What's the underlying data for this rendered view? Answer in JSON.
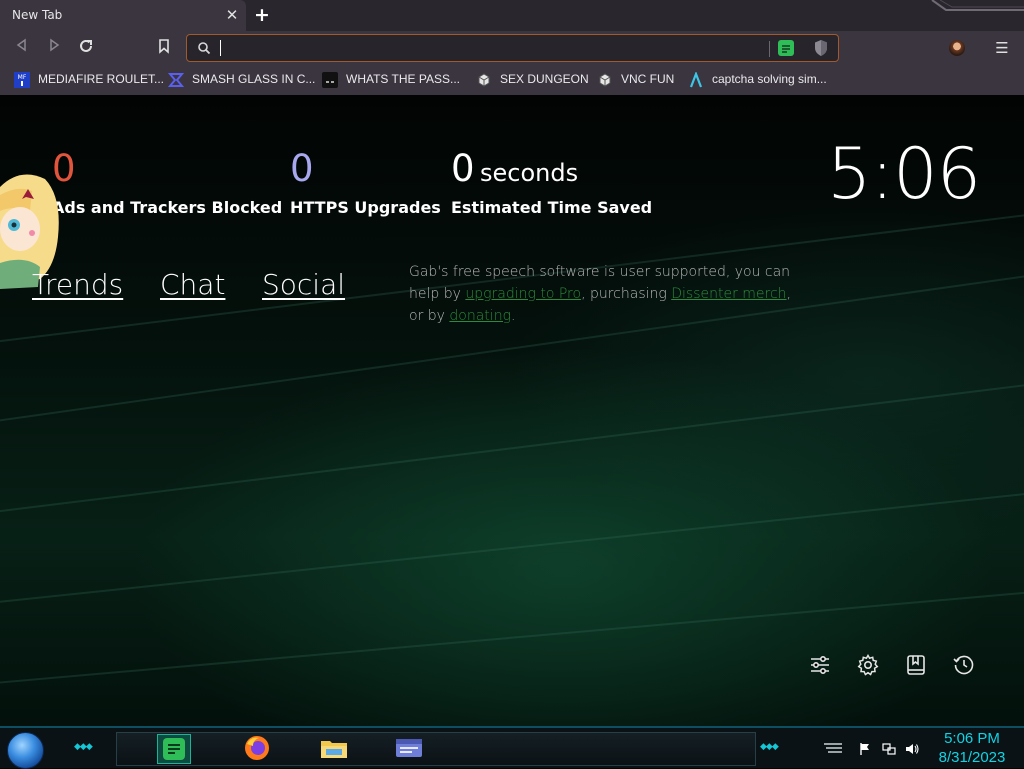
{
  "tab": {
    "title": "New Tab",
    "close_glyph": "✕",
    "new_tab_glyph": "+"
  },
  "toolbar": {
    "back_icon": "back-icon",
    "forward_icon": "forward-icon",
    "reload_icon": "reload-icon",
    "bookmark_icon": "bookmark-icon",
    "address_value": "",
    "menu_glyph": "☰"
  },
  "bookmarks": [
    {
      "label": "MEDIAFIRE ROULET...",
      "icon": "mediafire-icon"
    },
    {
      "label": "SMASH GLASS IN C...",
      "icon": "smash-glass-icon"
    },
    {
      "label": "WHATS THE PASS...",
      "icon": "terminal-icon"
    },
    {
      "label": "SEX DUNGEON",
      "icon": "sketch-icon"
    },
    {
      "label": "VNC FUN",
      "icon": "sketch-icon"
    },
    {
      "label": "captcha solving sim...",
      "icon": "lambda-icon"
    }
  ],
  "stats": {
    "ads_blocked": {
      "value": "0",
      "label": "Ads and Trackers Blocked",
      "color": "#e2553d"
    },
    "https_upgrades": {
      "value": "0",
      "label": "HTTPS Upgrades",
      "color": "#a8a8ee"
    },
    "time_saved": {
      "value": "0",
      "unit": "seconds",
      "label": "Estimated Time Saved",
      "color": "#ffffff"
    }
  },
  "clock": "5:06",
  "gab_links": [
    "Trends",
    "Chat",
    "Social"
  ],
  "gab_message": {
    "part1": "Gab's free speech software is user supported, you can help by ",
    "link1": "upgrading to Pro",
    "part2": ", purchasing ",
    "link2": "Dissenter merch",
    "part3": ", or by ",
    "link3": "donating",
    "part4": "."
  },
  "bottom_icons": [
    "customize-icon",
    "settings-icon",
    "bookmarks-icon",
    "history-icon"
  ],
  "taskbar": {
    "apps": [
      "dissenter-app-icon",
      "firefox-icon",
      "file-explorer-icon",
      "window-app-icon"
    ],
    "time": "5:06 PM",
    "date": "8/31/2023",
    "accent": "#12d3e3"
  }
}
